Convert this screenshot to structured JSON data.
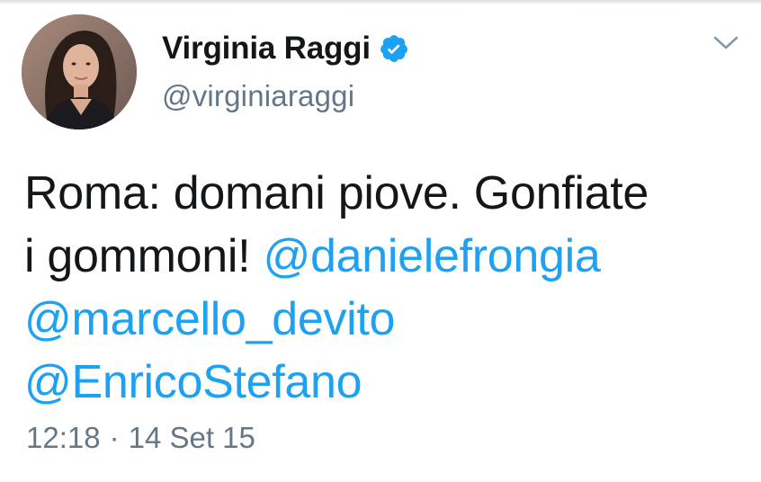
{
  "tweet": {
    "author": {
      "display_name": "Virginia Raggi",
      "handle": "@virginiaraggi",
      "verified": true,
      "avatar_icon": "profile-photo"
    },
    "menu_icon": "chevron-down-icon",
    "text_plain": "Roma: domani piove. Gonfiate i gommoni!",
    "text_line1": "Roma: domani piove. Gonfiate",
    "text_line2": "i gommoni!",
    "mentions": [
      "@danielefrongia",
      "@marcello_devito",
      "@EnricoStefano"
    ],
    "time": "12:18",
    "separator": "·",
    "date": "14 Set 15"
  },
  "colors": {
    "text_primary": "#14171a",
    "text_secondary": "#657786",
    "link": "#1da1f2",
    "verified_badge": "#1da1f2"
  }
}
